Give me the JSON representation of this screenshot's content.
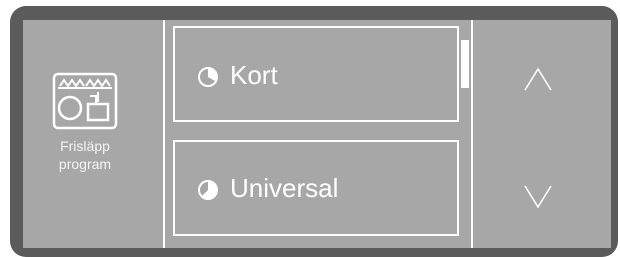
{
  "left_panel": {
    "label_line1": "Frisläpp",
    "label_line2": "program",
    "icon": "dishwasher-rack-icon"
  },
  "programs": [
    {
      "label": "Kort",
      "icon": "pie-quarter-icon"
    },
    {
      "label": "Universal",
      "icon": "pie-half-icon"
    }
  ],
  "navigation": {
    "up_icon": "chevron-up-icon",
    "down_icon": "chevron-down-icon"
  },
  "colors": {
    "bezel": "#5b5b5b",
    "screen": "#a7a7a7",
    "foreground": "#ffffff"
  }
}
